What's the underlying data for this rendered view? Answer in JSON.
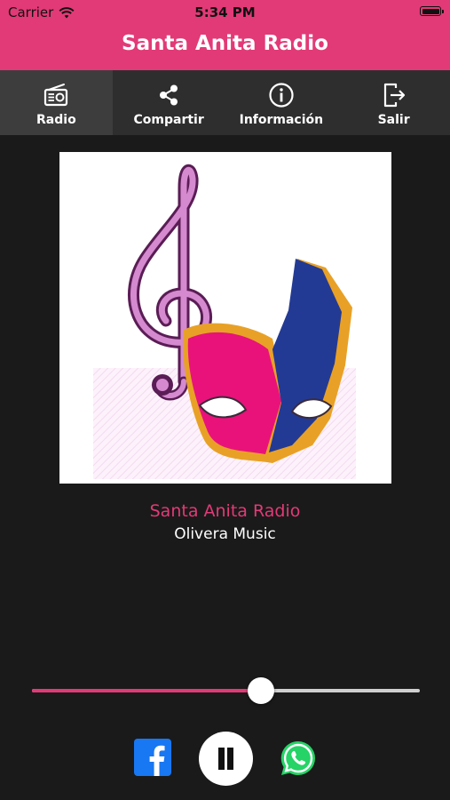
{
  "status": {
    "carrier": "Carrier",
    "time": "5:34 PM"
  },
  "header": {
    "title": "Santa Anita Radio"
  },
  "tabs": [
    {
      "label": "Radio",
      "icon": "radio-icon",
      "active": true
    },
    {
      "label": "Compartir",
      "icon": "share-icon",
      "active": false
    },
    {
      "label": "Información",
      "icon": "info-icon",
      "active": false
    },
    {
      "label": "Salir",
      "icon": "exit-icon",
      "active": false
    }
  ],
  "player": {
    "station_name": "Santa Anita Radio",
    "subtitle": "Olivera Music",
    "volume": 0.59,
    "state": "playing"
  },
  "colors": {
    "accent": "#e23a76",
    "background": "#1a1a1a",
    "tabbar": "#2e2e2e"
  }
}
